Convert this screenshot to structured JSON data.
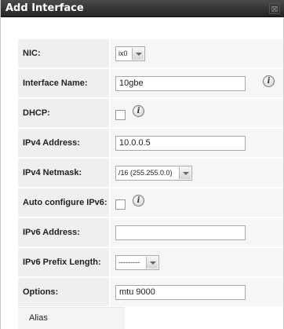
{
  "dialog": {
    "title": "Add Interface",
    "close_glyph": "⊠"
  },
  "fields": {
    "nic": {
      "label": "NIC:",
      "value": "ix0"
    },
    "interface_name": {
      "label": "Interface Name:",
      "value": "10gbe"
    },
    "dhcp": {
      "label": "DHCP:",
      "checked": false
    },
    "ipv4_address": {
      "label": "IPv4 Address:",
      "value": "10.0.0.5"
    },
    "ipv4_netmask": {
      "label": "IPv4 Netmask:",
      "value": "/16 (255.255.0.0)"
    },
    "auto_ipv6": {
      "label": "Auto configure IPv6:",
      "checked": false
    },
    "ipv6_address": {
      "label": "IPv6 Address:",
      "value": ""
    },
    "ipv6_prefix": {
      "label": "IPv6 Prefix Length:",
      "value": "---------"
    },
    "options": {
      "label": "Options:",
      "value": "mtu 9000"
    }
  },
  "help_glyph": "i",
  "tabs": {
    "alias": "Alias"
  },
  "icons": {
    "help": "info-icon",
    "dropdown": "chevron-down-icon",
    "close": "close-icon"
  }
}
